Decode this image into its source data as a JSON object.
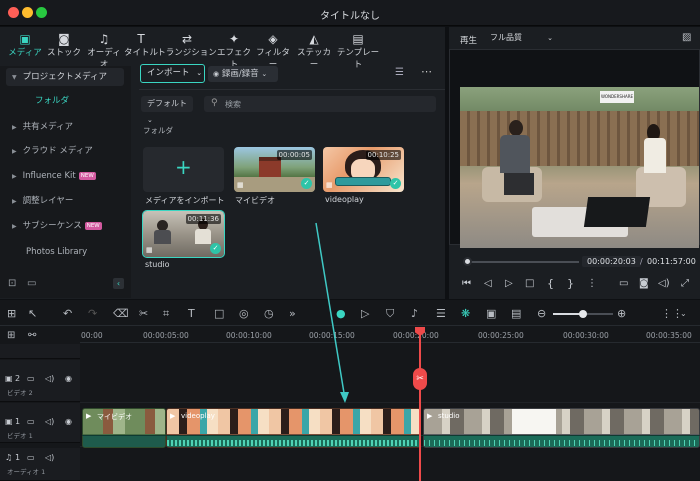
{
  "window": {
    "title": "タイトルなし"
  },
  "tabs": [
    {
      "label": "メディア",
      "icon": "media-icon"
    },
    {
      "label": "ストック",
      "icon": "stock-icon"
    },
    {
      "label": "オーディオ",
      "icon": "music-note-icon"
    },
    {
      "label": "タイトル",
      "icon": "title-t-icon"
    },
    {
      "label": "トランジション",
      "icon": "transition-icon"
    },
    {
      "label": "エフェクト",
      "icon": "effect-sparkle-icon"
    },
    {
      "label": "フィルター",
      "icon": "filter-icon"
    },
    {
      "label": "ステッカー",
      "icon": "sticker-icon"
    },
    {
      "label": "テンプレート",
      "icon": "template-icon"
    }
  ],
  "sidebar": {
    "items": [
      {
        "label": "プロジェクトメディア"
      },
      {
        "label": "フォルダ"
      },
      {
        "label": "共有メディア"
      },
      {
        "label": "クラウド メディア"
      },
      {
        "label": "Influence Kit",
        "badge": "NEW"
      },
      {
        "label": "調整レイヤー"
      },
      {
        "label": "サブシーケンス",
        "badge": "NEW"
      },
      {
        "label": "Photos Library"
      }
    ]
  },
  "media": {
    "import_label": "インポート",
    "record_label": "録画/録音",
    "default_label": "デフォルト",
    "search_placeholder": "検索",
    "folder_heading": "フォルダ",
    "import_tile_label": "メディアをインポート",
    "items": [
      {
        "name": "マイビデオ",
        "duration": "00:00:05"
      },
      {
        "name": "videoplay",
        "duration": "00:10:25"
      },
      {
        "name": "studio",
        "duration": "00:11:36"
      }
    ]
  },
  "preview": {
    "label": "再生",
    "quality": "フル品質",
    "current_time": "00:00:20:03",
    "separator": "/",
    "total_time": "00:11:57:00",
    "logo_text": "WONDERSHARE",
    "playhead_progress": 0.03
  },
  "timeline": {
    "ruler": [
      "00:00",
      "00:00:05:00",
      "00:00:10:00",
      "00:00:15:00",
      "00:00:20:00",
      "00:00:25:00",
      "00:00:30:00",
      "00:00:35:00"
    ],
    "tracks": {
      "video2": "ビデオ 2",
      "video1": "ビデオ 1",
      "audio1": "オーディオ 1",
      "video2_num": "2",
      "video1_num": "1",
      "audio1_num": "1"
    },
    "clips": {
      "first": "マイビデオ",
      "second": "videoplay",
      "third": "studio"
    }
  },
  "colors": {
    "accent": "#3ad6c2",
    "playhead": "#ee4a4a",
    "new_badge": "#d35aa0"
  }
}
